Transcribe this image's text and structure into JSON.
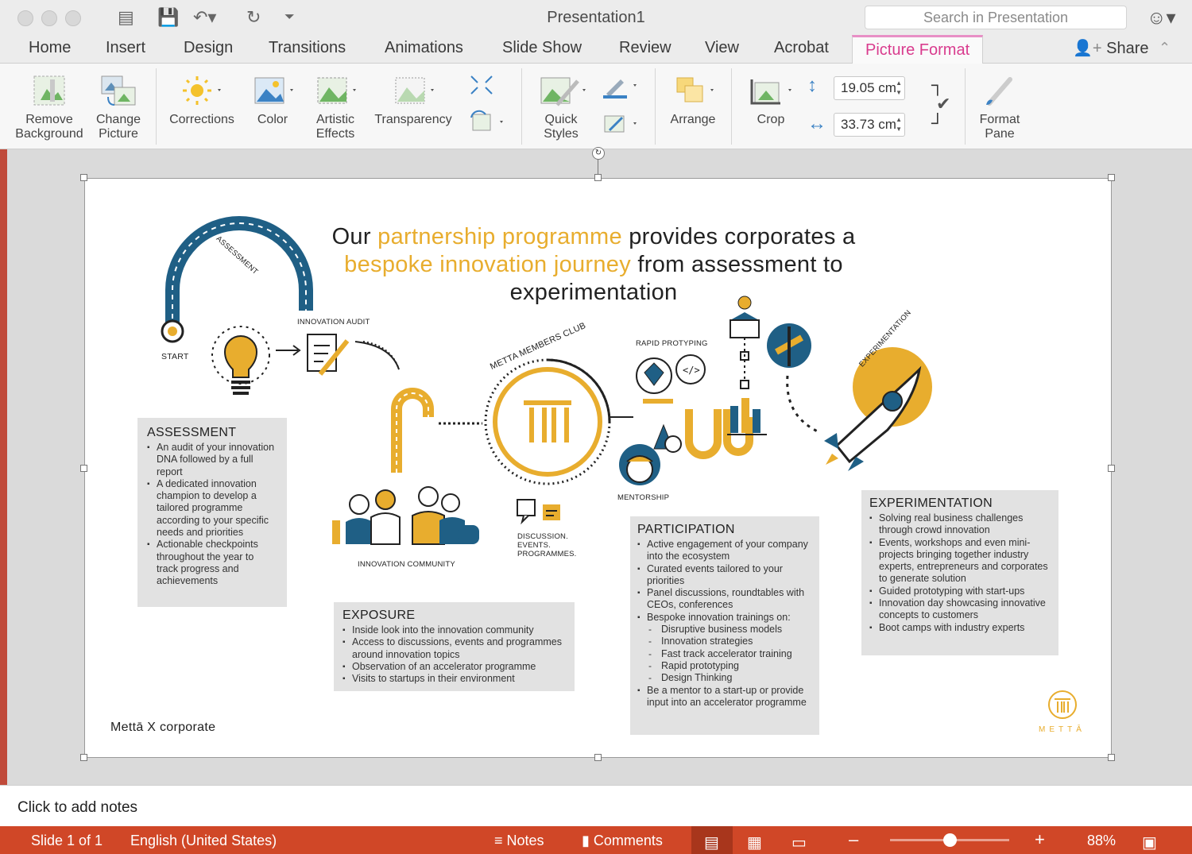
{
  "window": {
    "title": "Presentation1",
    "search_placeholder": "Search in Presentation"
  },
  "menu_tabs": [
    "Home",
    "Insert",
    "Design",
    "Transitions",
    "Animations",
    "Slide Show",
    "Review",
    "View",
    "Acrobat",
    "Picture Format"
  ],
  "active_tab": "Picture Format",
  "share_label": "Share",
  "ribbon": {
    "remove_bg": [
      "Remove",
      "Background"
    ],
    "change_picture": [
      "Change",
      "Picture"
    ],
    "corrections": "Corrections",
    "color": "Color",
    "artistic_effects": [
      "Artistic",
      "Effects"
    ],
    "transparency": "Transparency",
    "quick_styles": [
      "Quick",
      "Styles"
    ],
    "arrange": "Arrange",
    "crop": "Crop",
    "height_value": "19.05 cm",
    "width_value": "33.73 cm",
    "format_pane": [
      "Format",
      "Pane"
    ]
  },
  "slide": {
    "headline": {
      "p1": "Our ",
      "a1": "partnership programme",
      "p2": " provides corporates a ",
      "a2": "bespoke innovation journey",
      "p3": " from assessment to experimentation"
    },
    "labels": {
      "start": "START",
      "assessment_arc": "ASSESSMENT",
      "innovation_audit": "INNOVATION AUDIT",
      "members_club": "METTA MEMBERS CLUB",
      "rapid_prototyping": "RAPID PROTYPING",
      "mentorship": "MENTORSHIP",
      "experimentation_arc": "EXPERIMENTATION",
      "innovation_community": "INNOVATION COMMUNITY",
      "discussion": [
        "DISCUSSION.",
        "EVENTS.",
        "PROGRAMMES."
      ]
    },
    "assessment": {
      "title": "ASSESSMENT",
      "items": [
        "An audit of your innovation DNA followed by a full report",
        "A dedicated innovation champion to develop a tailored programme according to your specific needs and priorities",
        "Actionable checkpoints throughout the year to track progress and achievements"
      ]
    },
    "exposure": {
      "title": "EXPOSURE",
      "items": [
        "Inside look into the innovation community",
        "Access to discussions, events and programmes around innovation topics",
        "Observation of an accelerator programme",
        "Visits to startups in their environment"
      ]
    },
    "participation": {
      "title": "PARTICIPATION",
      "items": [
        "Active engagement of your company into the ecosystem",
        "Curated events tailored to your priorities",
        "Panel discussions, roundtables with CEOs, conferences",
        "Bespoke innovation trainings on:"
      ],
      "subitems": [
        "Disruptive business models",
        "Innovation strategies",
        "Fast track accelerator training",
        "Rapid prototyping",
        "Design Thinking"
      ],
      "last": "Be a mentor to a start-up or provide input into an accelerator programme"
    },
    "experimentation": {
      "title": "EXPERIMENTATION",
      "items": [
        "Solving real business challenges through crowd innovation",
        "Events, workshops and even mini-projects bringing together industry experts, entrepreneurs and corporates to generate solution",
        "Guided prototyping with start-ups",
        "Innovation day showcasing innovative concepts to customers",
        "Boot camps with industry experts"
      ]
    },
    "footer_left": "Mettā X corporate",
    "logo_text": "METTĀ"
  },
  "notes_placeholder": "Click to add notes",
  "status": {
    "slide": "Slide 1 of 1",
    "language": "English (United States)",
    "notes": "Notes",
    "comments": "Comments",
    "zoom": "88%",
    "zoom_level": 0.5
  },
  "colors": {
    "accent": "#e8ad2e",
    "blue": "#1f5f85",
    "status": "#d04727",
    "tab_active": "#d93c8e"
  }
}
